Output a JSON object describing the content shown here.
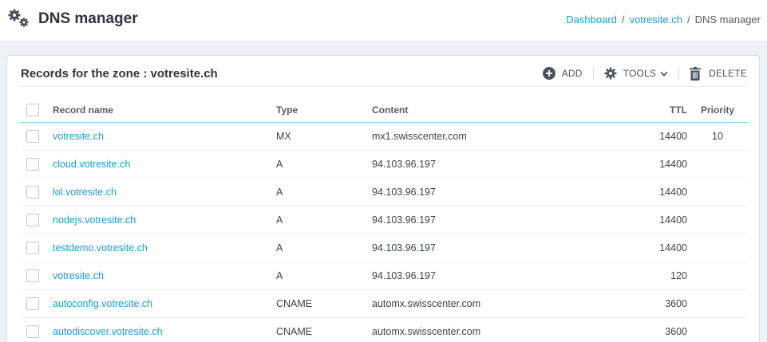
{
  "page": {
    "title": "DNS manager",
    "icon": "gears-icon"
  },
  "breadcrumb": {
    "items": [
      "Dashboard",
      "votresite.ch",
      "DNS manager"
    ],
    "separator": "/"
  },
  "card": {
    "title": "Records for the zone : votresite.ch",
    "actions": {
      "add": "ADD",
      "tools": "TOOLS",
      "delete": "DELETE"
    }
  },
  "table": {
    "columns": [
      "Record name",
      "Type",
      "Content",
      "TTL",
      "Priority"
    ],
    "rows": [
      {
        "name": "votresite.ch",
        "type": "MX",
        "content": "mx1.swisscenter.com",
        "ttl": "14400",
        "priority": "10"
      },
      {
        "name": "cloud.votresite.ch",
        "type": "A",
        "content": "94.103.96.197",
        "ttl": "14400",
        "priority": ""
      },
      {
        "name": "lol.votresite.ch",
        "type": "A",
        "content": "94.103.96.197",
        "ttl": "14400",
        "priority": ""
      },
      {
        "name": "nodejs.votresite.ch",
        "type": "A",
        "content": "94.103.96.197",
        "ttl": "14400",
        "priority": ""
      },
      {
        "name": "testdemo.votresite.ch",
        "type": "A",
        "content": "94.103.96.197",
        "ttl": "14400",
        "priority": ""
      },
      {
        "name": "votresite.ch",
        "type": "A",
        "content": "94.103.96.197",
        "ttl": "120",
        "priority": ""
      },
      {
        "name": "autoconfig.votresite.ch",
        "type": "CNAME",
        "content": "automx.swisscenter.com",
        "ttl": "3600",
        "priority": ""
      },
      {
        "name": "autodiscover.votresite.ch",
        "type": "CNAME",
        "content": "automx.swisscenter.com",
        "ttl": "3600",
        "priority": ""
      }
    ]
  },
  "colors": {
    "accent": "#1a9ad6",
    "background": "#edf0f4",
    "text": "#333a44"
  }
}
